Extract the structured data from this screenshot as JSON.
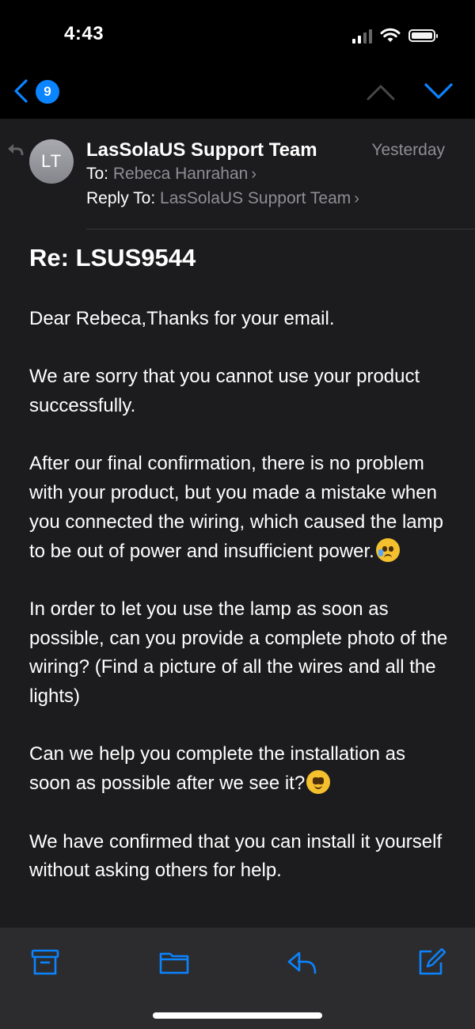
{
  "status_bar": {
    "time": "4:43"
  },
  "nav": {
    "unread_count": "9"
  },
  "message": {
    "sender": "LasSolaUS Support Team",
    "avatar_initials": "LT",
    "date": "Yesterday",
    "to_label": "To:",
    "to_value": "Rebeca Hanrahan",
    "reply_to_label": "Reply To:",
    "reply_to_value": "LasSolaUS Support Team",
    "subject": "Re: LSUS9544",
    "paragraphs": [
      "Dear Rebeca,Thanks for your email.",
      "We are sorry that you cannot use your product successfully.",
      "After our final confirmation, there is no problem with your product, but you made a mistake when you connected the wiring, which caused the lamp to be out of power and insufficient power.",
      "In order to let you use the lamp as soon as possible, can you provide a complete photo of the wiring? (Find a picture of all the wires and all the lights)",
      "Can we help you complete the installation as soon as possible after we see it?",
      "We have confirmed that you can install it yourself without asking others for help."
    ]
  },
  "icons": {
    "back": "chevron-left-icon",
    "up": "chevron-up-icon",
    "down": "chevron-down-icon",
    "archive": "archive-icon",
    "move": "folder-icon",
    "reply": "reply-icon",
    "compose": "compose-icon"
  },
  "colors": {
    "accent": "#0a84ff",
    "background": "#1c1c1e",
    "secondary_text": "#8e8e93"
  }
}
